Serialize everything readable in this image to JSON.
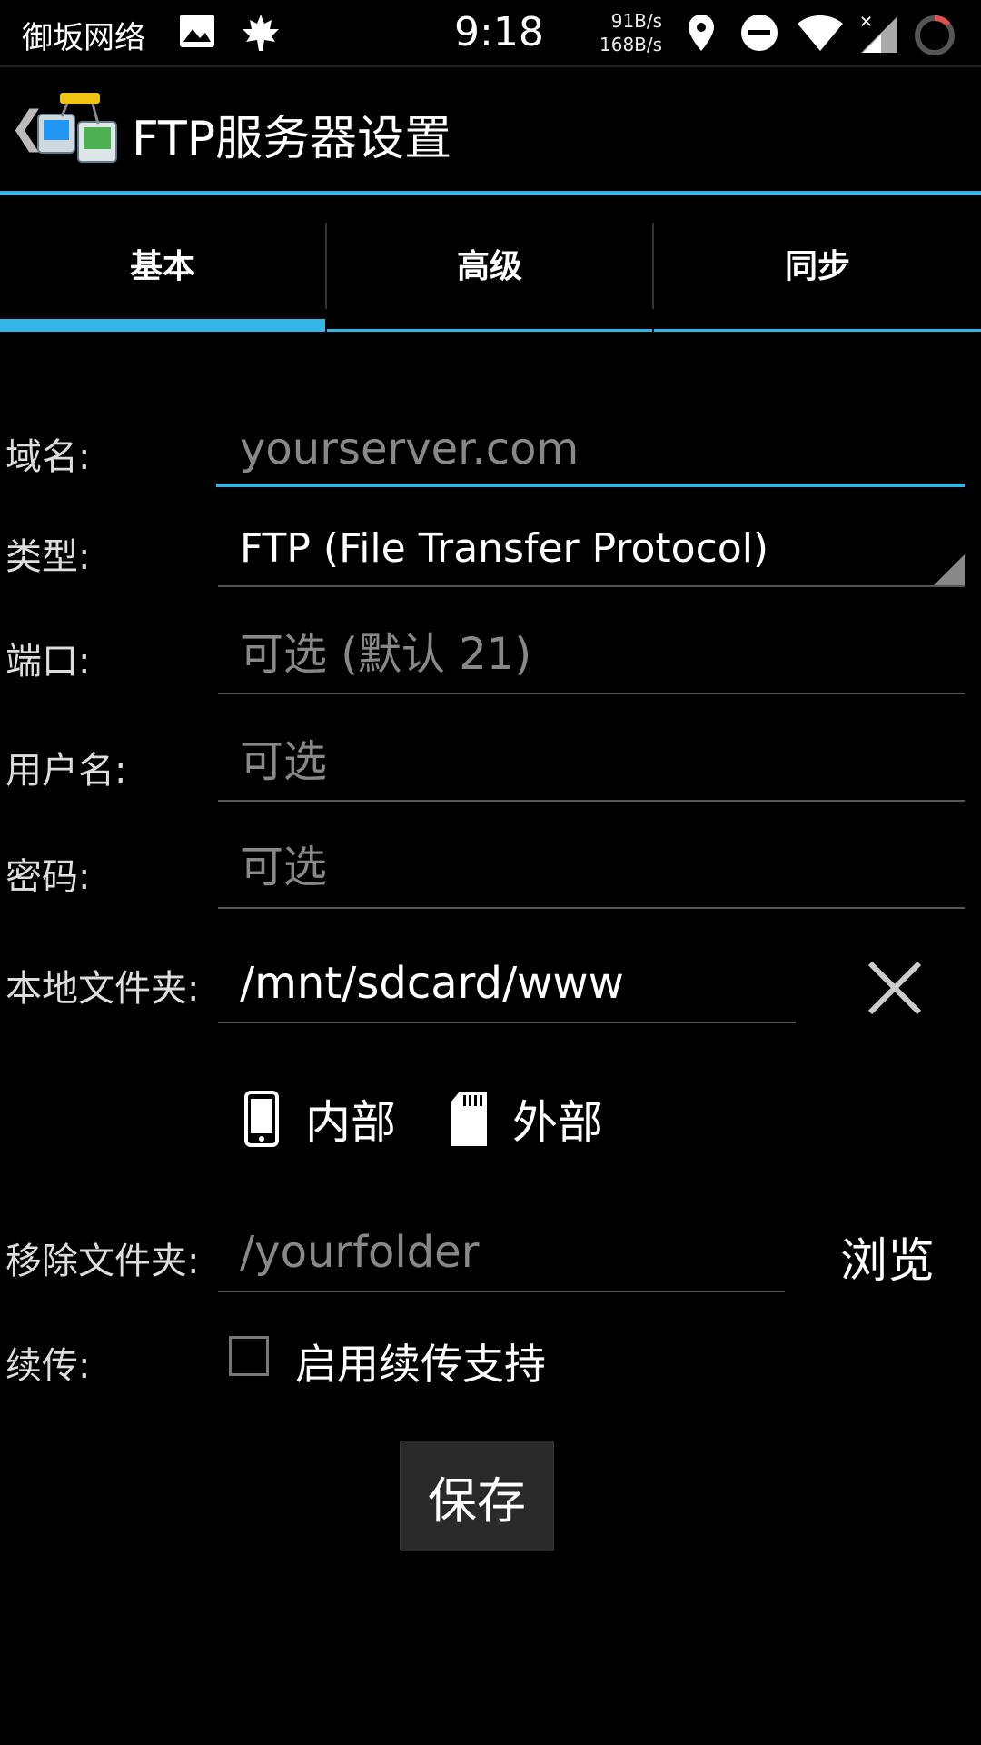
{
  "status_bar": {
    "carrier": "御坂网络",
    "time": "9:18",
    "speed_up": "91B/s",
    "speed_down": "168B/s",
    "icons": [
      "image-icon",
      "maple-leaf-icon",
      "location-icon",
      "dnd-icon",
      "wifi-icon",
      "signal-icon",
      "sync-icon"
    ]
  },
  "action_bar": {
    "title": "FTP服务器设置",
    "back_glyph": "❮",
    "accent_color": "#33b5e5"
  },
  "tabs": [
    {
      "label": "基本",
      "active": true
    },
    {
      "label": "高级",
      "active": false
    },
    {
      "label": "同步",
      "active": false
    }
  ],
  "form": {
    "domain": {
      "label": "域名:",
      "placeholder": "yourserver.com"
    },
    "type": {
      "label": "类型:",
      "value": "FTP (File Transfer Protocol)"
    },
    "port": {
      "label": "端口:",
      "placeholder": "可选 (默认 21)"
    },
    "username": {
      "label": "用户名:",
      "placeholder": "可选"
    },
    "password": {
      "label": "密码:",
      "placeholder": "可选"
    },
    "local_folder": {
      "label": "本地文件夹:",
      "value": "/mnt/sdcard/www"
    },
    "storage": {
      "internal": "内部",
      "external": "外部"
    },
    "remote_folder": {
      "label": "移除文件夹:",
      "placeholder": "/yourfolder",
      "browse": "浏览"
    },
    "resume": {
      "label": "续传:",
      "checkbox_label": "启用续传支持",
      "checked": false
    }
  },
  "save_label": "保存"
}
